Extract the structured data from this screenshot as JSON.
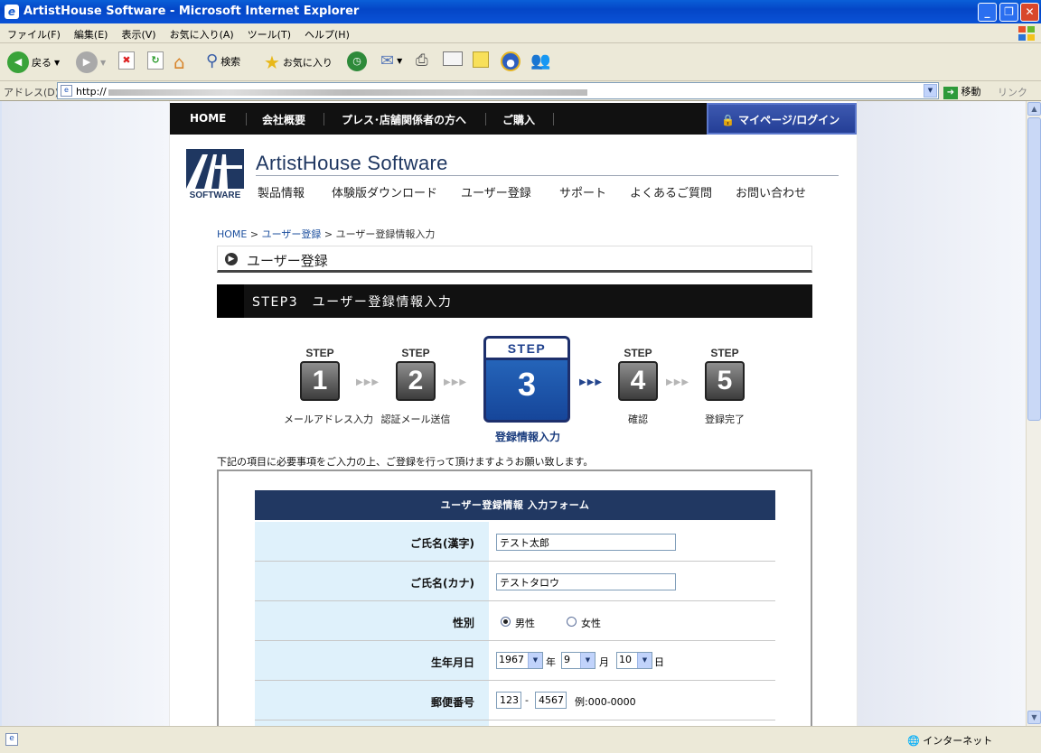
{
  "window": {
    "title": "ArtistHouse Software - Microsoft Internet Explorer",
    "buttons": [
      "_",
      "❐",
      "✕"
    ]
  },
  "menu": [
    "ファイル(F)",
    "編集(E)",
    "表示(V)",
    "お気に入り(A)",
    "ツール(T)",
    "ヘルプ(H)"
  ],
  "toolbar": {
    "back_label": "戻る",
    "search_label": "検索",
    "favorites_label": "お気に入り"
  },
  "address": {
    "label": "アドレス(D)",
    "url_prefix": "http://",
    "go_label": "移動",
    "links_label": "リンク"
  },
  "status": {
    "zone_label": "インターネット"
  },
  "site": {
    "topnav": [
      "HOME",
      "会社概要",
      "プレス･店舗関係者の方へ",
      "ご購入"
    ],
    "mypage_label": "マイページ/ログイン",
    "logo_text": "SOFTWARE",
    "brand_name": "ArtistHouse Software",
    "globalnav": [
      "製品情報",
      "体験版ダウンロード",
      "ユーザー登録",
      "サポート",
      "よくあるご質問",
      "お問い合わせ"
    ],
    "breadcrumb": {
      "home": "HOME",
      "sep": " > ",
      "user_reg": "ユーザー登録",
      "current": "ユーザー登録情報入力"
    },
    "section_title": "ユーザー登録",
    "step_bar_title": "STEP3　ユーザー登録情報入力",
    "steps": [
      {
        "label": "STEP",
        "number": "1",
        "caption": "メールアドレス入力"
      },
      {
        "label": "STEP",
        "number": "2",
        "caption": "認証メール送信"
      },
      {
        "label": "STEP",
        "number": "3",
        "caption": "登録情報入力"
      },
      {
        "label": "STEP",
        "number": "4",
        "caption": "確認"
      },
      {
        "label": "STEP",
        "number": "5",
        "caption": "登録完了"
      }
    ],
    "step_arrows": "▶▶▶",
    "intro": "下記の項目に必要事項をご入力の上、ご登録を行って頂けますようお願い致します。",
    "form": {
      "header": "ユーザー登録情報 入力フォーム",
      "name_kanji_label": "ご氏名(漢字)",
      "name_kanji_value": "テスト太郎",
      "name_kana_label": "ご氏名(カナ)",
      "name_kana_value": "テストタロウ",
      "gender_label": "性別",
      "gender_male": "男性",
      "gender_female": "女性",
      "gender_selected": "男性",
      "birth_label": "生年月日",
      "birth_year": "1967",
      "birth_year_unit": "年",
      "birth_month": "9",
      "birth_month_unit": "月",
      "birth_day": "10",
      "birth_day_unit": "日",
      "zip_label": "郵便番号",
      "zip1": "123",
      "zip_sep": "-",
      "zip2": "4567",
      "zip_example": "例:000-0000"
    }
  },
  "colors": {
    "ie_blue": "#0a52d6",
    "nav_black": "#111111",
    "mypage_blue": "#2e4aa3",
    "form_header": "#213862",
    "form_label_bg": "#dff1fb",
    "step_active": "#1d4fa0"
  }
}
